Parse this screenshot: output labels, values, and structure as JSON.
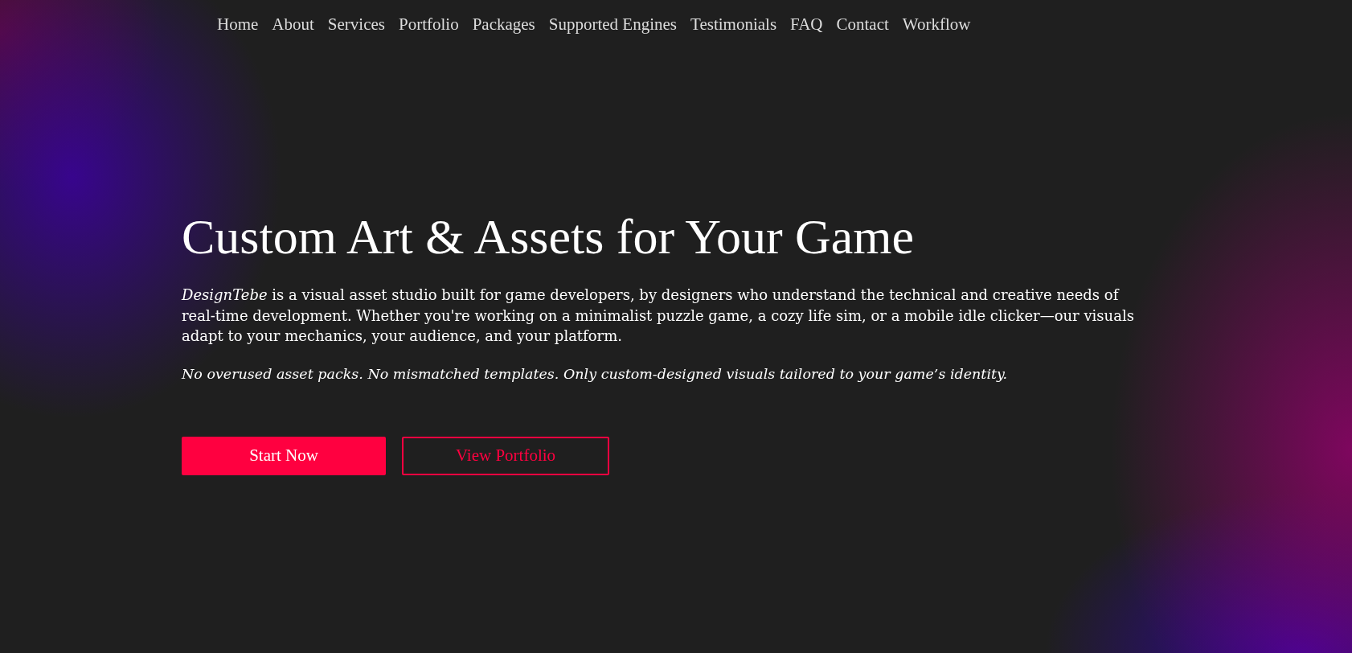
{
  "nav": {
    "links": [
      "Home",
      "About",
      "Services",
      "Portfolio",
      "Packages",
      "Supported Engines",
      "Testimonials",
      "FAQ",
      "Contact",
      "Workflow"
    ]
  },
  "hero": {
    "title": "Custom Art & Assets for Your Game",
    "description": "*DesignTebe* is a visual asset studio built for game developers, by designers who understand the technical and creative needs of real-time development. Whether you're working on a minimalist puzzle game, a cozy life sim, or a mobile idle clicker—our visuals adapt to your mechanics, your audience, and your platform.",
    "tagline": "No overused asset packs. No mismatched templates. Only custom-designed visuals tailored to your game’s identity.",
    "buttons": [
      {
        "label": "Start Now",
        "kind": "primary"
      },
      {
        "label": "View Portfolio",
        "kind": "outline"
      }
    ]
  }
}
